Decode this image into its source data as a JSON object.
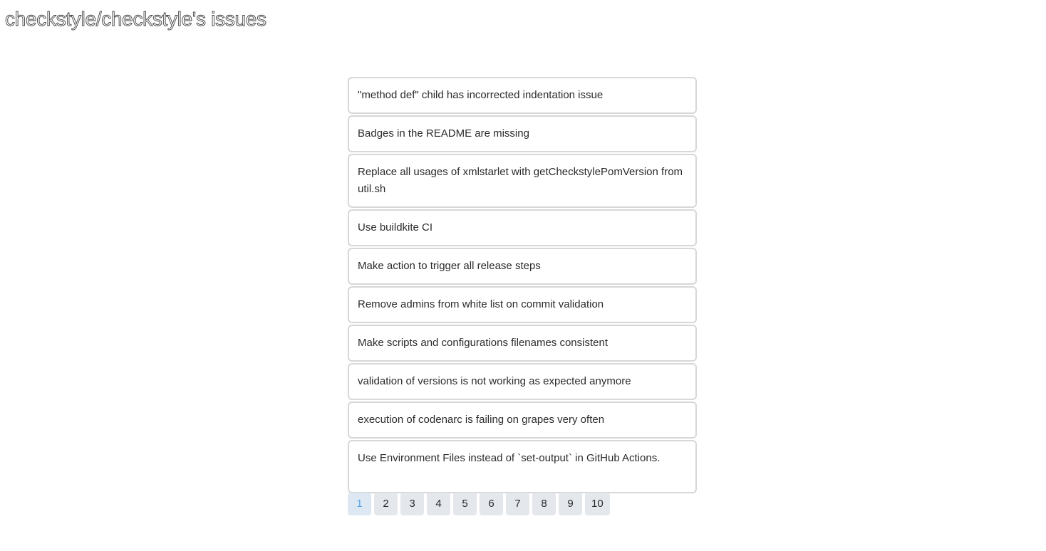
{
  "header": {
    "title": "checkstyle/checkstyle's issues"
  },
  "issues": [
    {
      "title": "\"method def\" child has incorrected indentation issue"
    },
    {
      "title": "Badges in the README are missing"
    },
    {
      "title": "Replace all usages of xmlstarlet with getCheckstylePomVersion from util.sh"
    },
    {
      "title": "Use buildkite CI"
    },
    {
      "title": "Make action to trigger all release steps"
    },
    {
      "title": "Remove admins from white list on commit validation"
    },
    {
      "title": "Make scripts and configurations filenames consistent"
    },
    {
      "title": "validation of versions is not working as expected anymore"
    },
    {
      "title": "execution of codenarc is failing on grapes very often"
    },
    {
      "title": "Use Environment Files instead of `set-output` in GitHub Actions."
    }
  ],
  "pagination": {
    "current": "1",
    "pages": [
      "1",
      "2",
      "3",
      "4",
      "5",
      "6",
      "7",
      "8",
      "9",
      "10"
    ]
  },
  "colors": {
    "active_page_text": "#5aa4e6",
    "page_button_bg": "#e4e7eb",
    "item_border": "#d7d7d7"
  }
}
